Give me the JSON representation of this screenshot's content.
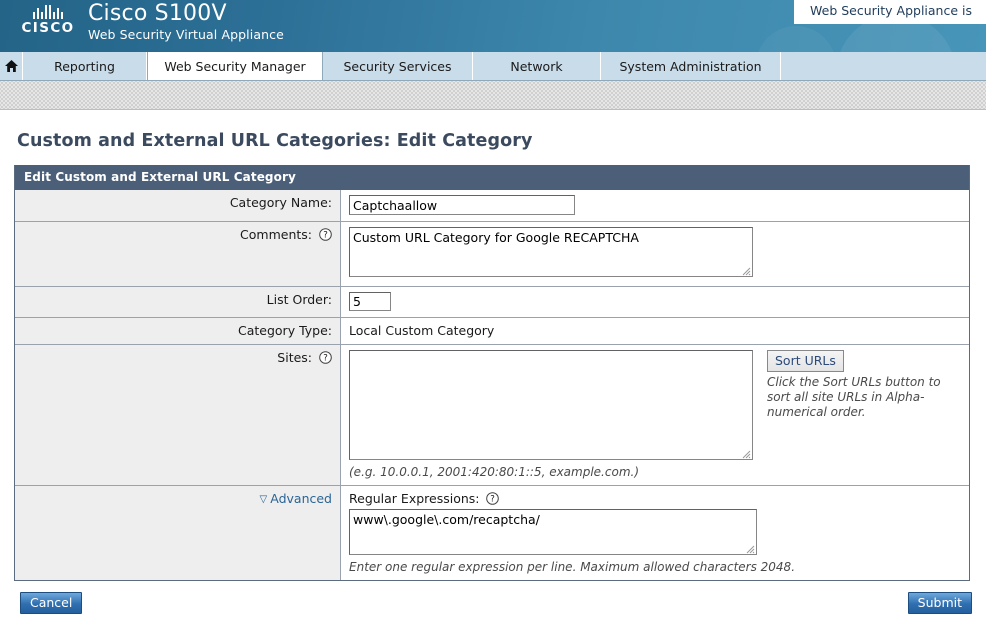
{
  "banner": {
    "brand": "CISCO",
    "product_name": "Cisco S100V",
    "product_subtitle": "Web Security Virtual Appliance",
    "notification": "Web Security Appliance is",
    "gradient_start": "#236487",
    "gradient_end": "#4795b8"
  },
  "nav": {
    "home_icon": "home-icon",
    "tabs": [
      {
        "label": "Reporting",
        "active": false
      },
      {
        "label": "Web Security Manager",
        "active": true
      },
      {
        "label": "Security Services",
        "active": false
      },
      {
        "label": "Network",
        "active": false
      },
      {
        "label": "System Administration",
        "active": false
      }
    ]
  },
  "page": {
    "title": "Custom and External URL Categories: Edit Category"
  },
  "panel": {
    "header": "Edit Custom and External URL Category",
    "header_bg": "#4c5f79",
    "rows": {
      "category_name": {
        "label": "Category Name:",
        "value": "Captchaallow"
      },
      "comments": {
        "label": "Comments:",
        "help_icon": "question-mark-icon",
        "value": "Custom URL Category for Google RECAPTCHA"
      },
      "list_order": {
        "label": "List Order:",
        "value": "5"
      },
      "category_type": {
        "label": "Category Type:",
        "value": "Local Custom Category"
      },
      "sites": {
        "label": "Sites:",
        "help_icon": "question-mark-icon",
        "value": "",
        "hint": "(e.g. 10.0.0.1, 2001:420:80:1::5, example.com.)",
        "sort_button": "Sort URLs",
        "sort_hint": "Click the Sort URLs button to sort all site URLs in Alpha-numerical order."
      },
      "advanced": {
        "toggle_label": "Advanced",
        "toggle_icon": "chevron-down-icon",
        "regex_label": "Regular Expressions:",
        "help_icon": "question-mark-icon",
        "regex_value": "www\\.google\\.com/recaptcha/",
        "regex_hint": "Enter one regular expression per line. Maximum allowed characters 2048."
      }
    }
  },
  "footer": {
    "cancel_label": "Cancel",
    "submit_label": "Submit",
    "button_color": "#2f6fb0"
  }
}
